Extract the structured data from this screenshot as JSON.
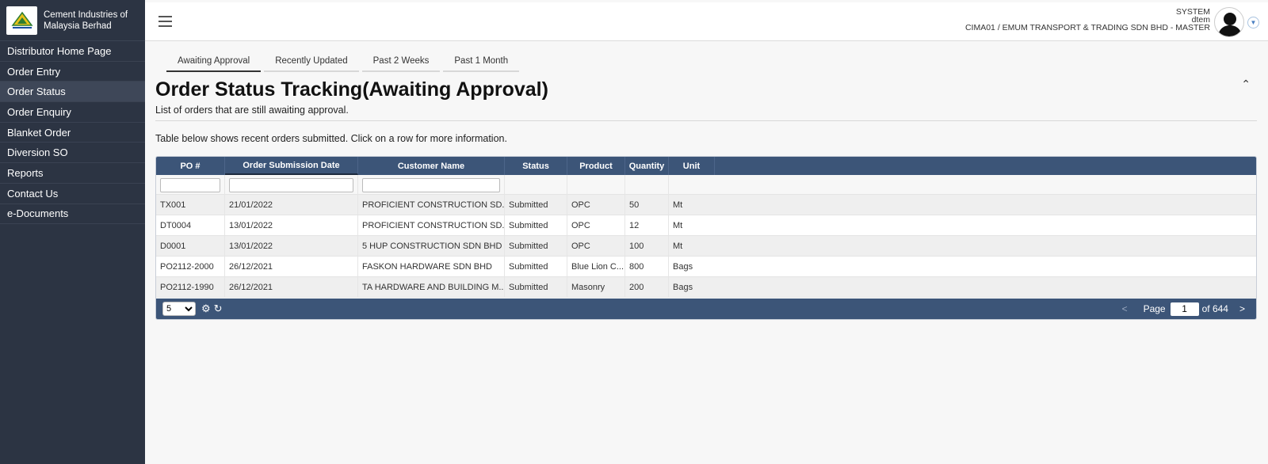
{
  "brand": {
    "name_line1": "Cement Industries of",
    "name_line2": "Malaysia Berhad"
  },
  "sidebar": {
    "items": [
      {
        "label": "Distributor Home Page"
      },
      {
        "label": "Order Entry"
      },
      {
        "label": "Order Status"
      },
      {
        "label": "Order Enquiry"
      },
      {
        "label": "Blanket Order"
      },
      {
        "label": "Diversion SO"
      },
      {
        "label": "Reports"
      },
      {
        "label": "Contact Us"
      },
      {
        "label": "e-Documents"
      }
    ],
    "active_index": 2
  },
  "user": {
    "role": "SYSTEM",
    "username": "dtem",
    "company": "CIMA01 / EMUM TRANSPORT & TRADING SDN BHD - MASTER"
  },
  "tabs": [
    {
      "label": "Awaiting Approval",
      "active": true
    },
    {
      "label": "Recently Updated",
      "active": false
    },
    {
      "label": "Past 2 Weeks",
      "active": false
    },
    {
      "label": "Past 1 Month",
      "active": false
    }
  ],
  "page": {
    "title": "Order Status Tracking(Awaiting Approval)",
    "subtitle": "List of orders that are still awaiting approval.",
    "table_description": "Table below shows recent orders submitted.  Click on a row for more information."
  },
  "table": {
    "columns": [
      "PO #",
      "Order Submission Date",
      "Customer Name",
      "Status",
      "Product",
      "Quantity",
      "Unit"
    ],
    "rows": [
      [
        "TX001",
        "21/01/2022",
        "PROFICIENT CONSTRUCTION SD...",
        "Submitted",
        "OPC",
        "50",
        "Mt"
      ],
      [
        "DT0004",
        "13/01/2022",
        "PROFICIENT CONSTRUCTION SD...",
        "Submitted",
        "OPC",
        "12",
        "Mt"
      ],
      [
        "D0001",
        "13/01/2022",
        "5 HUP CONSTRUCTION SDN BHD",
        "Submitted",
        "OPC",
        "100",
        "Mt"
      ],
      [
        "PO2112-2000",
        "26/12/2021",
        "FASKON HARDWARE SDN BHD",
        "Submitted",
        "Blue Lion C...",
        "800",
        "Bags"
      ],
      [
        "PO2112-1990",
        "26/12/2021",
        "TA HARDWARE AND BUILDING M...",
        "Submitted",
        "Masonry",
        "200",
        "Bags"
      ]
    ]
  },
  "pager": {
    "page_size": "5",
    "page_label": "Page",
    "current_page": "1",
    "total_label": "of 644",
    "prev": "<",
    "next": ">"
  },
  "colors": {
    "sidebar_bg": "#2c3443",
    "grid_header_bg": "#3c5578"
  }
}
